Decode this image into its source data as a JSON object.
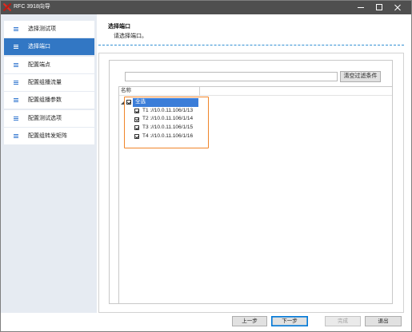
{
  "window": {
    "title": "RFC 3918向导",
    "app_icon": "app-logo-icon",
    "controls": {
      "minimize_icon": "minimize-icon",
      "maximize_icon": "maximize-icon",
      "close_icon": "close-icon"
    }
  },
  "sidebar": {
    "items": [
      {
        "label": "选择测试项",
        "icon": "list-icon",
        "selected": false
      },
      {
        "label": "选择端口",
        "icon": "list-icon",
        "selected": true
      },
      {
        "label": "配置端点",
        "icon": "list-icon",
        "selected": false
      },
      {
        "label": "配置组播流量",
        "icon": "list-icon",
        "selected": false
      },
      {
        "label": "配置组播参数",
        "icon": "list-icon",
        "selected": false
      },
      {
        "label": "配置测试选项",
        "icon": "list-icon",
        "selected": false
      },
      {
        "label": "配置组转发矩阵",
        "icon": "list-icon",
        "selected": false
      }
    ]
  },
  "header": {
    "title": "选择端口",
    "subtitle": "请选择端口。"
  },
  "filter": {
    "value": "",
    "clear_label": "清空过滤条件"
  },
  "port_list": {
    "column_header": "名称",
    "select_all": {
      "label": "全选",
      "checked": true,
      "expanded": true,
      "selected": true,
      "expander_icon": "expand-triangle-icon"
    },
    "ports": [
      {
        "label": "T1 ://10.0.11.106/1/13",
        "checked": true
      },
      {
        "label": "T2 ://10.0.11.106/1/14",
        "checked": true
      },
      {
        "label": "T3 ://10.0.11.106/1/15",
        "checked": true
      },
      {
        "label": "T4 ://10.0.11.106/1/16",
        "checked": true
      }
    ]
  },
  "footer": {
    "prev": {
      "label": "上一步"
    },
    "next": {
      "label": "下一步",
      "focused": true
    },
    "finish": {
      "label": "完成",
      "disabled": true
    },
    "exit": {
      "label": "退出"
    }
  },
  "colors": {
    "title_bar": "#4f4f4f",
    "accent": "#3277c4",
    "selection": "#3b7dd8",
    "divider": "#2f8fd3",
    "highlight_box": "#f0852a",
    "focus": "#0078d7"
  }
}
